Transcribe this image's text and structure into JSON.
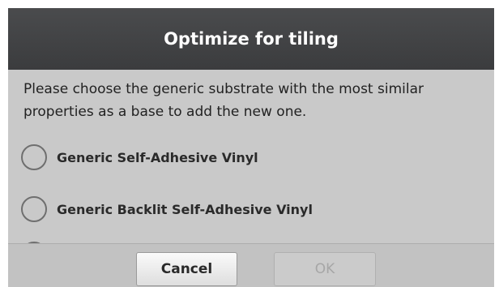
{
  "dialog": {
    "title": "Optimize for tiling",
    "description": "Please choose the generic substrate with the most similar properties as a base to add the new one.",
    "options": [
      {
        "label": "Generic Self-Adhesive Vinyl",
        "selected": false
      },
      {
        "label": "Generic Backlit Self-Adhesive Vinyl",
        "selected": false
      }
    ],
    "buttons": {
      "cancel": "Cancel",
      "ok": "OK"
    }
  }
}
